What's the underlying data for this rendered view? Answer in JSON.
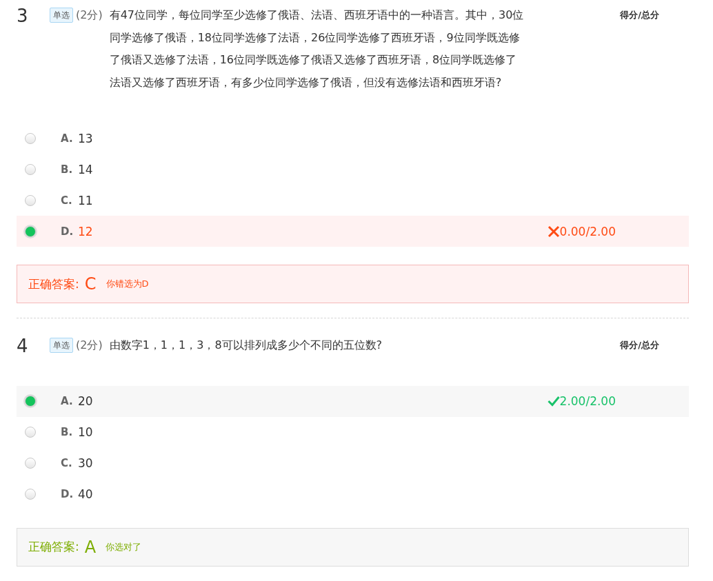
{
  "questions": [
    {
      "number": "3",
      "type_tag": "单选",
      "points": "(2分)",
      "text": "有47位同学，每位同学至少选修了俄语、法语、西班牙语中的一种语言。其中，30位同学选修了俄语，18位同学选修了法语，26位同学选修了西班牙语，9位同学既选修了俄语又选修了法语，16位同学既选修了俄语又选修了西班牙语，8位同学既选修了法语又选修了西班牙语，有多少位同学选修了俄语，但没有选修法语和西班牙语?",
      "score_header": "得分/总分",
      "options": [
        {
          "letter": "A.",
          "text": "13",
          "selected": false
        },
        {
          "letter": "B.",
          "text": "14",
          "selected": false
        },
        {
          "letter": "C.",
          "text": "11",
          "selected": false
        },
        {
          "letter": "D.",
          "text": "12",
          "selected": true
        }
      ],
      "result": {
        "kind": "wrong",
        "score": "0.00/2.00"
      },
      "answer": {
        "label": "正确答案:",
        "letter": "C",
        "note": "你错选为D"
      }
    },
    {
      "number": "4",
      "type_tag": "单选",
      "points": "(2分)",
      "text": "由数字1，1，1，3，8可以排列成多少个不同的五位数?",
      "score_header": "得分/总分",
      "options": [
        {
          "letter": "A.",
          "text": "20",
          "selected": true
        },
        {
          "letter": "B.",
          "text": "10",
          "selected": false
        },
        {
          "letter": "C.",
          "text": "30",
          "selected": false
        },
        {
          "letter": "D.",
          "text": "40",
          "selected": false
        }
      ],
      "result": {
        "kind": "right",
        "score": "2.00/2.00"
      },
      "answer": {
        "label": "正确答案:",
        "letter": "A",
        "note": "你选对了"
      }
    }
  ]
}
